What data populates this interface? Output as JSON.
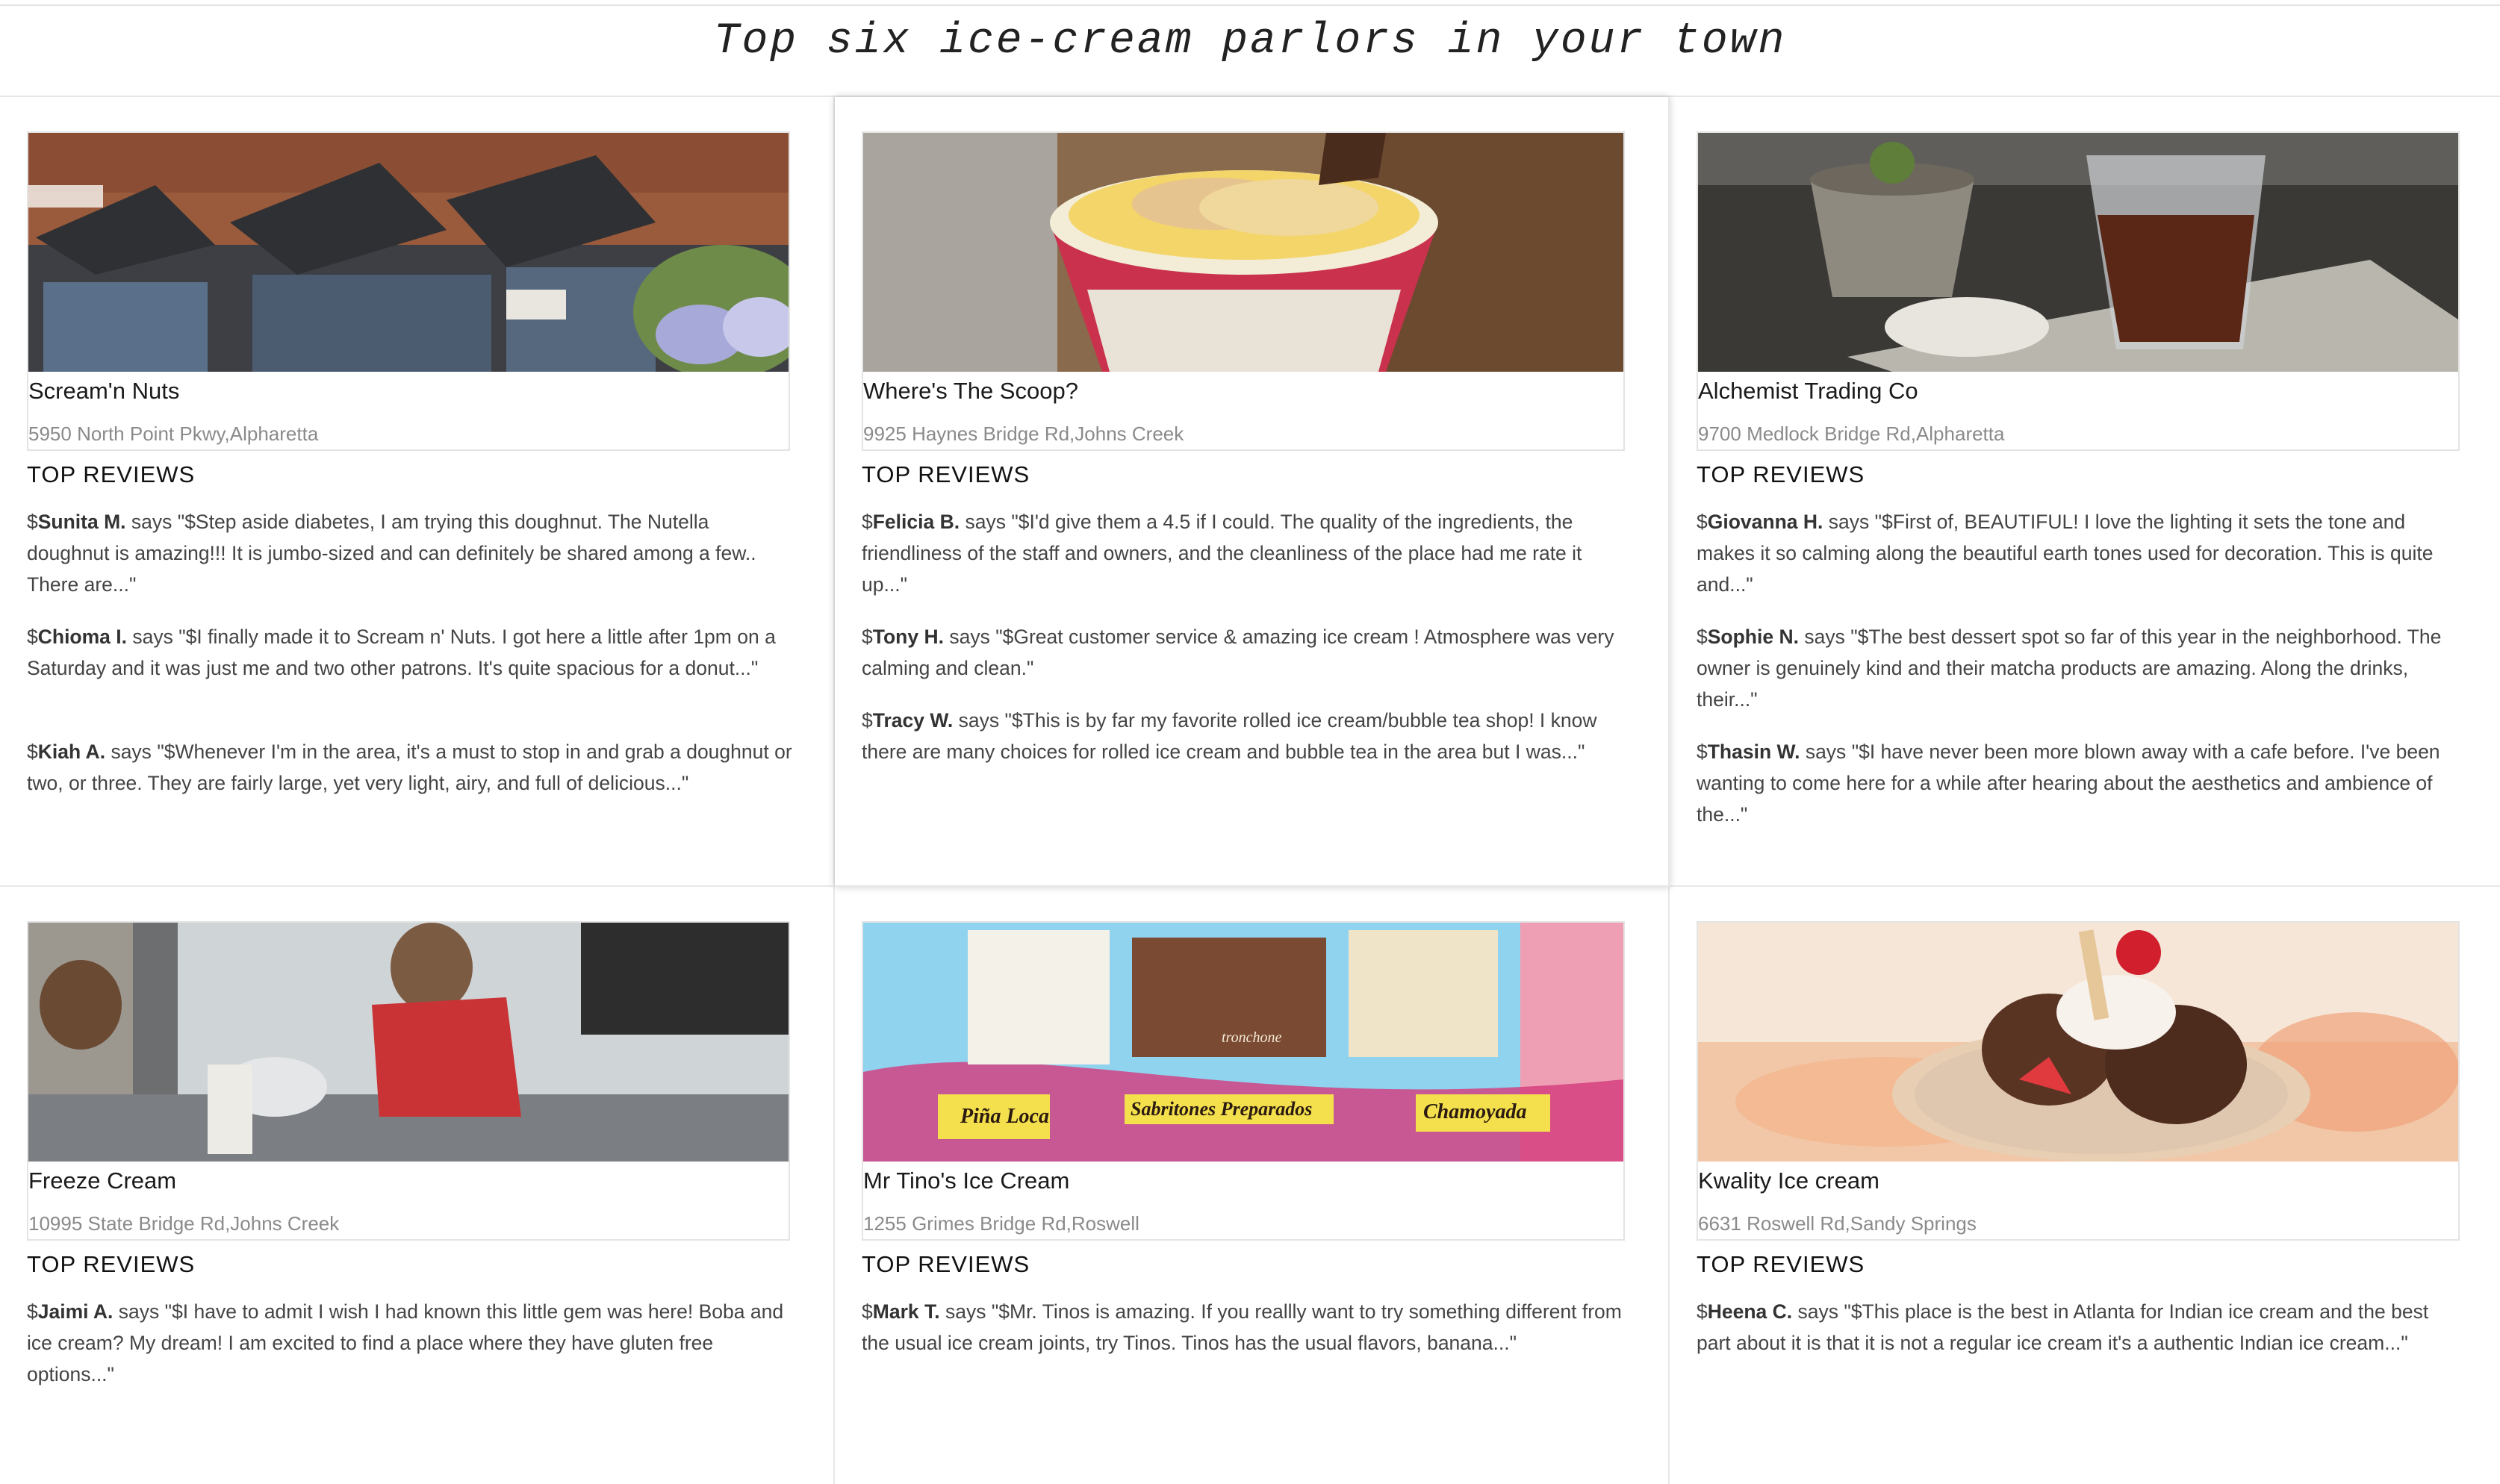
{
  "page": {
    "title": "Top six ice-cream parlors in your town"
  },
  "review_prefix": "$",
  "review_verb": "says",
  "parlors": [
    {
      "name": "Scream'n Nuts",
      "address": "5950 North Point Pkwy,Alpharetta",
      "reviews_heading": "TOP REVIEWS",
      "photo": "storefront-photo",
      "reviews": [
        {
          "author": "Sunita M.",
          "text": "\"$Step aside diabetes, I am trying this doughnut. The Nutella doughnut is amazing!!! It is jumbo-sized and can definitely be shared among a few.. There are...\""
        },
        {
          "author": "Chioma I.",
          "text": "\"$I finally made it to Scream n' Nuts. I got here a little after 1pm on a Saturday and it was just me and two other patrons. It's quite spacious for a donut...\""
        },
        {
          "author": "Kiah A.",
          "text": "\"$Whenever I'm in the area, it's a must to stop in and grab a doughnut or two, or three. They are fairly large, yet very light, airy, and full of delicious...\""
        }
      ]
    },
    {
      "name": "Where's The Scoop?",
      "address": "9925 Haynes Bridge Rd,Johns Creek",
      "reviews_heading": "TOP REVIEWS",
      "photo": "rolled-ice-cream-cup-photo",
      "reviews": [
        {
          "author": "Felicia B.",
          "text": "\"$I'd give them a 4.5 if I could. The quality of the ingredients, the friendliness of the staff and owners, and the cleanliness of the place had me rate it up...\""
        },
        {
          "author": "Tony H.",
          "text": "\"$Great customer service & amazing ice cream ! Atmosphere was very calming and clean.\""
        },
        {
          "author": "Tracy W.",
          "text": "\"$This is by far my favorite rolled ice cream/bubble tea shop! I know there are many choices for rolled ice cream and bubble tea in the area but I was...\""
        }
      ]
    },
    {
      "name": "Alchemist Trading Co",
      "address": "9700 Medlock Bridge Rd,Alpharetta",
      "reviews_heading": "TOP REVIEWS",
      "photo": "cold-brew-glass-photo",
      "reviews": [
        {
          "author": "Giovanna H.",
          "text": "\"$First of, BEAUTIFUL! I love the lighting it sets the tone and makes it so calming along the beautiful earth tones used for decoration. This is quite and...\""
        },
        {
          "author": "Sophie N.",
          "text": "\"$The best dessert spot so far of this year in the neighborhood. The owner is genuinely kind and their matcha products are amazing. Along the drinks, their...\""
        },
        {
          "author": "Thasin W.",
          "text": "\"$I have never been more blown away with a cafe before. I've been wanting to come here for a while after hearing about the aesthetics and ambience of the...\""
        }
      ]
    },
    {
      "name": "Freeze Cream",
      "address": "10995 State Bridge Rd,Johns Creek",
      "reviews_heading": "TOP REVIEWS",
      "photo": "ice-cream-counter-photo",
      "reviews": [
        {
          "author": "Jaimi A.",
          "text": "\"$I have to admit I wish I had known this little gem was here! Boba and ice cream? My dream! I am excited to find a place where they have gluten free options...\""
        }
      ]
    },
    {
      "name": "Mr Tino's Ice Cream",
      "address": "1255 Grimes Bridge Rd,Roswell",
      "reviews_heading": "TOP REVIEWS",
      "photo": "menu-board-photo",
      "photo_labels": [
        "Piña Loca",
        "Sabritones Preparados",
        "Chamoyada",
        "tronchone"
      ],
      "reviews": [
        {
          "author": "Mark T.",
          "text": "\"$Mr. Tinos is amazing. If you reallly want to try something different from the usual ice cream joints, try Tinos. Tinos has the usual flavors, banana...\""
        }
      ]
    },
    {
      "name": "Kwality Ice cream",
      "address": "6631 Roswell Rd,Sandy Springs",
      "reviews_heading": "TOP REVIEWS",
      "photo": "sundae-bowl-photo",
      "reviews": [
        {
          "author": "Heena C.",
          "text": "\"$This place is the best in Atlanta for Indian ice cream and the best part about it is that it is not a regular ice cream it's a authentic Indian ice cream...\""
        }
      ]
    }
  ]
}
